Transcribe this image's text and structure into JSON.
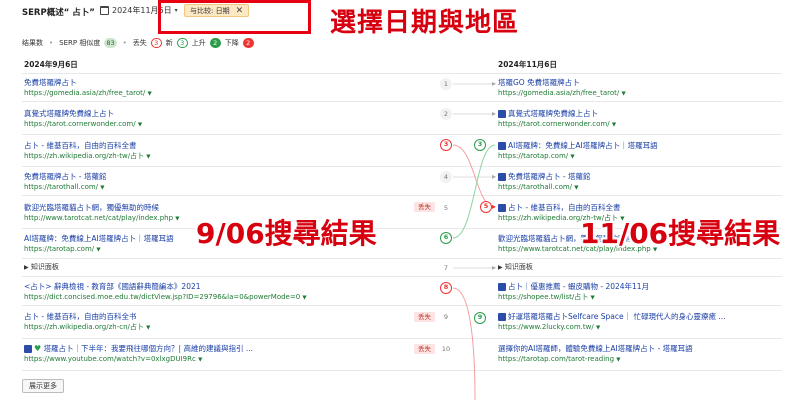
{
  "header": {
    "title": "SERP概述“ 占卜”",
    "date": "2024年11月6日",
    "compare_label": "与比较: 日期",
    "close_glyph": "✕"
  },
  "annotations": {
    "top": "選擇日期與地區",
    "left": "9/06搜尋結果",
    "right": "11/06搜尋結果"
  },
  "stats": {
    "results_label": "结果数",
    "similarity_label": "SERP 相似度",
    "similarity_value": "83",
    "lost_label": "丢失",
    "lost_value": "3",
    "new_label": "新",
    "new_value": "3",
    "up_label": "上升",
    "up_value": "2",
    "down_label": "下降",
    "down_value": "2"
  },
  "left": {
    "date": "2024年9月6日",
    "rows": [
      {
        "title": "免費塔羅牌占卜",
        "url": "https://gomedia.asia/zh/free_tarot/",
        "rank": "1"
      },
      {
        "title": "真覺式塔羅牌免費線上占卜",
        "url": "https://tarot.cornerwonder.com/",
        "rank": "2"
      },
      {
        "title": "占卜 - 維基百科，自由的百科全書",
        "url": "https://zh.wikipedia.org/zh-tw/占卜",
        "rank": "3"
      },
      {
        "title": "免費塔羅牌占卜 - 塔蘿館",
        "url": "https://tarothall.com/",
        "rank": "4"
      },
      {
        "title": "歡迎光臨塔羅貓占卜網，獨優無助的時候",
        "url": "http://www.tarotcat.net/cat/play/index.php",
        "rank": "5",
        "tag": "丢失"
      },
      {
        "title": "AI塔羅牌：免費線上AI塔羅牌占卜｜塔羅耳語",
        "url": "https://tarotap.com/",
        "rank": "6"
      },
      {
        "title": "知识面板",
        "rank": "7"
      },
      {
        "title": "<占卜> 辭典檢視 - 教育部《國語辭典簡編本》2021",
        "url": "https://dict.concised.moe.edu.tw/dictView.jsp?ID=29796&la=0&powerMode=0",
        "rank": "8"
      },
      {
        "title": "占卜 - 維基百科，自由的百科全书",
        "url": "https://zh.wikipedia.org/zh-cn/占卜",
        "rank": "9",
        "tag": "丢失"
      },
      {
        "title": "塔羅占卜｜下半年：我要飛往哪個方向？| 高維的建議與指引 ...",
        "url": "https://www.youtube.com/watch?v=0xlxgDUI9Rc",
        "rank": "10",
        "tag": "丢失"
      }
    ]
  },
  "right": {
    "date": "2024年11月6日",
    "rows": [
      {
        "title": "塔羅GO 免費塔羅牌占卜",
        "url": "https://gomedia.asia/zh/free_tarot/"
      },
      {
        "title": "真覺式塔羅牌免費線上占卜",
        "url": "https://tarot.cornerwonder.com/"
      },
      {
        "title": "AI塔羅牌：免費線上AI塔羅牌占卜｜塔羅耳語",
        "url": "https://tarotap.com/"
      },
      {
        "title": "免費塔羅牌占卜 - 塔蘿館",
        "url": "https://tarothall.com/"
      },
      {
        "title": "占卜 - 維基百科，自由的百科全書",
        "url": "https://zh.wikipedia.org/zh-tw/占卜"
      },
      {
        "title": "歡迎光臨塔羅貓占卜網，獨優無助的時候",
        "url": "https://www.tarotcat.net/cat/play/index.php"
      },
      {
        "title": "知识面板"
      },
      {
        "title": "占卜｜優惠推薦 - 蝦皮購物 - 2024年11月",
        "url": "https://shopee.tw/list/占卜"
      },
      {
        "title": "好運塔羅塔羅占卜Selfcare Space｜ 忙碌現代人的身心靈療癒 ...",
        "url": "https://www.2lucky.com.tw/"
      },
      {
        "title": "選擇你的AI塔羅師，體驗免費線上AI塔羅牌占卜 - 塔羅耳語",
        "url": "https://tarotap.com/tarot-reading"
      }
    ]
  },
  "footer": {
    "more_label": "展示更多"
  }
}
